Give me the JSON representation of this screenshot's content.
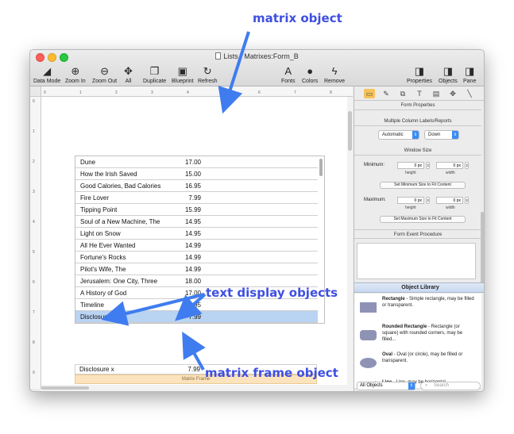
{
  "window": {
    "title": "Lists : Matrixes:Form_B"
  },
  "toolbar": {
    "left": [
      {
        "label": "Data Mode",
        "icon": "data-mode-icon",
        "glyph": "◢"
      },
      {
        "label": "Zoom In",
        "icon": "zoom-in-icon",
        "glyph": "⊕"
      },
      {
        "label": "Zoom Out",
        "icon": "zoom-out-icon",
        "glyph": "⊖"
      },
      {
        "label": "All",
        "icon": "all-icon",
        "glyph": "✥"
      },
      {
        "label": "Duplicate",
        "icon": "duplicate-icon",
        "glyph": "❐"
      },
      {
        "label": "Blueprint",
        "icon": "blueprint-icon",
        "glyph": "▣"
      },
      {
        "label": "Refresh",
        "icon": "refresh-icon",
        "glyph": "↻"
      }
    ],
    "middle": [
      {
        "label": "Fonts",
        "icon": "fonts-icon",
        "glyph": "A"
      },
      {
        "label": "Colors",
        "icon": "colors-icon",
        "glyph": "●"
      },
      {
        "label": "Remove",
        "icon": "remove-icon",
        "glyph": "ϟ"
      }
    ],
    "right": [
      {
        "label": "Properties",
        "icon": "properties-icon",
        "glyph": "◨"
      },
      {
        "label": "Objects",
        "icon": "objects-icon",
        "glyph": "◨"
      },
      {
        "label": "Pane",
        "icon": "pane-icon",
        "glyph": "◨"
      }
    ]
  },
  "ruler": {
    "ticks": [
      "0",
      "1",
      "2",
      "3",
      "4",
      "5",
      "6",
      "7",
      "8"
    ]
  },
  "vruler": {
    "ticks": [
      "0",
      "1",
      "2",
      "3",
      "4",
      "5",
      "6",
      "7",
      "8",
      "9"
    ]
  },
  "matrix": {
    "rows": [
      {
        "name": "Dune",
        "price": "17.00"
      },
      {
        "name": "How the Irish Saved",
        "price": "15.00"
      },
      {
        "name": "Good Calories, Bad Calories",
        "price": "16.95"
      },
      {
        "name": "Fire Lover",
        "price": "7.99"
      },
      {
        "name": "Tipping Point",
        "price": "15.99"
      },
      {
        "name": "Soul of a New Machine, The",
        "price": "14.95"
      },
      {
        "name": "Light on Snow",
        "price": "14.95"
      },
      {
        "name": "All He Ever Wanted",
        "price": "14.99"
      },
      {
        "name": "Fortune's Rocks",
        "price": "14.99"
      },
      {
        "name": "Pilot's Wife, The",
        "price": "14.99"
      },
      {
        "name": "Jerusalem: One City, Three",
        "price": "18.00"
      },
      {
        "name": "A History of God",
        "price": "17.00"
      },
      {
        "name": "Timeline",
        "price": "14.95"
      },
      {
        "name": "Disclosure x",
        "price": "7.99"
      }
    ],
    "selected_index": 13
  },
  "display": {
    "name": "Disclosure x",
    "price": "7.99",
    "frame_label": "Matrix Frame"
  },
  "panel": {
    "tabs": [
      "form-icon",
      "pencil-icon",
      "link-icon",
      "text-icon",
      "script-icon",
      "move-icon",
      "line-icon"
    ],
    "tab_glyphs": [
      "▭",
      "✎",
      "⧉",
      "T",
      "▤",
      "✥",
      "╲"
    ],
    "form_properties": "Form Properties",
    "multi_col": "Multiple Column Labels/Reports",
    "mode_value": "Automatic",
    "direction_value": "Down",
    "window_size": "Window Size",
    "minimum_label": "Minimum:",
    "maximum_label": "Maximum:",
    "min_height": "0 px",
    "min_width": "0 px",
    "max_height": "0 px",
    "max_width": "0 px",
    "height_label": "height",
    "width_label": "width",
    "set_min_button": "Set Minimum Size to Fit Content",
    "set_max_button": "Set Maximum Size to Fit Content",
    "event_procedure": "Form Event Procedure"
  },
  "library": {
    "title": "Object Library",
    "items": [
      {
        "name": "Rectangle",
        "desc": " - Simple rectangle, may be filled or transparent."
      },
      {
        "name": "Rounded Rectangle",
        "desc": " - Rectangle (or square) with rounded corners, may be filled..."
      },
      {
        "name": "Oval",
        "desc": " - Oval (or circle), may be filled or transparent."
      },
      {
        "name": "Line",
        "desc": " - Line, may be horizontal,"
      }
    ],
    "filter_value": "All Objects",
    "search_placeholder": "Search"
  },
  "annotations": {
    "matrix_object": "matrix object",
    "text_display_objects": "text display objects",
    "matrix_frame_object": "matrix frame object"
  },
  "colors": {
    "annotation": "#3f4fe0",
    "selection": "#b9d3f2",
    "frame": "#fbe3bd"
  }
}
